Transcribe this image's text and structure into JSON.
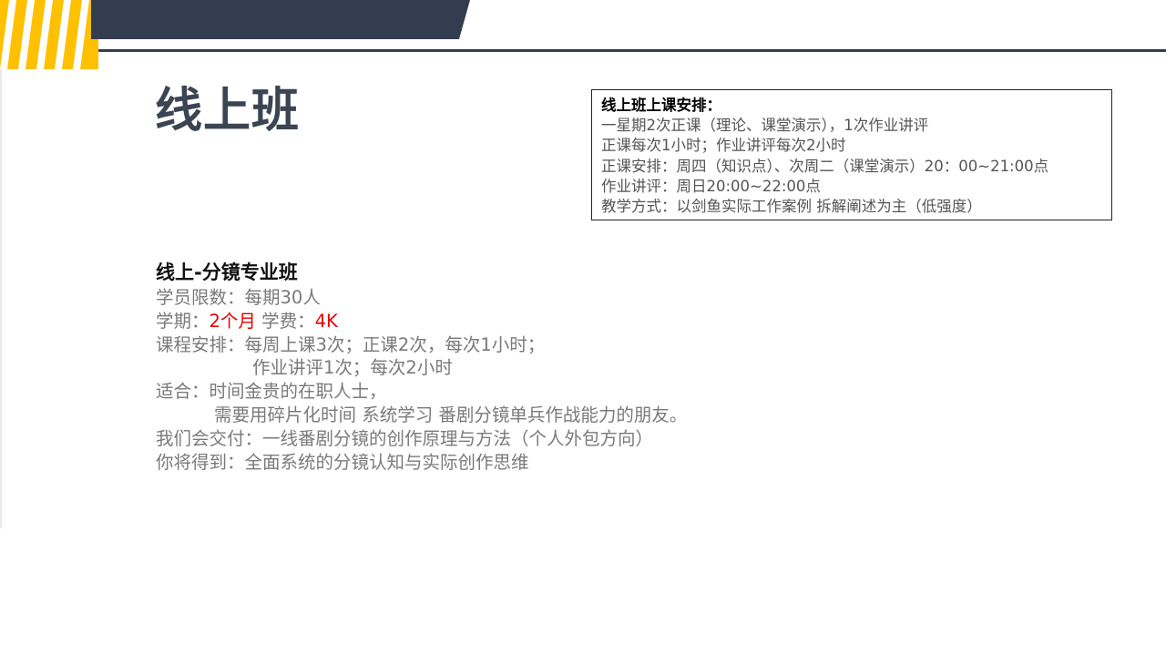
{
  "page": {
    "title": "线上班"
  },
  "schedule": {
    "title": "线上班上课安排：",
    "lines": [
      "一星期2次正课（理论、课堂演示），1次作业讲评",
      "正课每次1小时；作业讲评每次2小时",
      "正课安排：周四（知识点）、次周二（课堂演示）20：00~21:00点",
      "作业讲评：周日20:00~22:00点",
      "教学方式：以剑鱼实际工作案例 拆解阐述为主（低强度）"
    ]
  },
  "course": {
    "heading": "线上-分镜专业班",
    "limit": "学员限数：每期30人",
    "period_label": "学期：",
    "period_value": "2个月",
    "fee_label": " 学费：",
    "fee_value": "4K",
    "arrangement_1": "课程安排：每周上课3次；正课2次，每次1小时；",
    "arrangement_2": "作业讲评1次；每次2小时",
    "suitable_1": "适合：时间金贵的在职人士，",
    "suitable_2": "需要用碎片化时间 系统学习 番剧分镜单兵作战能力的朋友。",
    "deliver": "我们会交付：一线番剧分镜的创作原理与方法（个人外包方向）",
    "gain": "你将得到：全面系统的分镜认知与实际创作思维"
  },
  "colors": {
    "accent_yellow": "#ffc000",
    "header_dark": "#323e4f",
    "title_gray": "#3b4453",
    "highlight_red": "#e60000"
  }
}
